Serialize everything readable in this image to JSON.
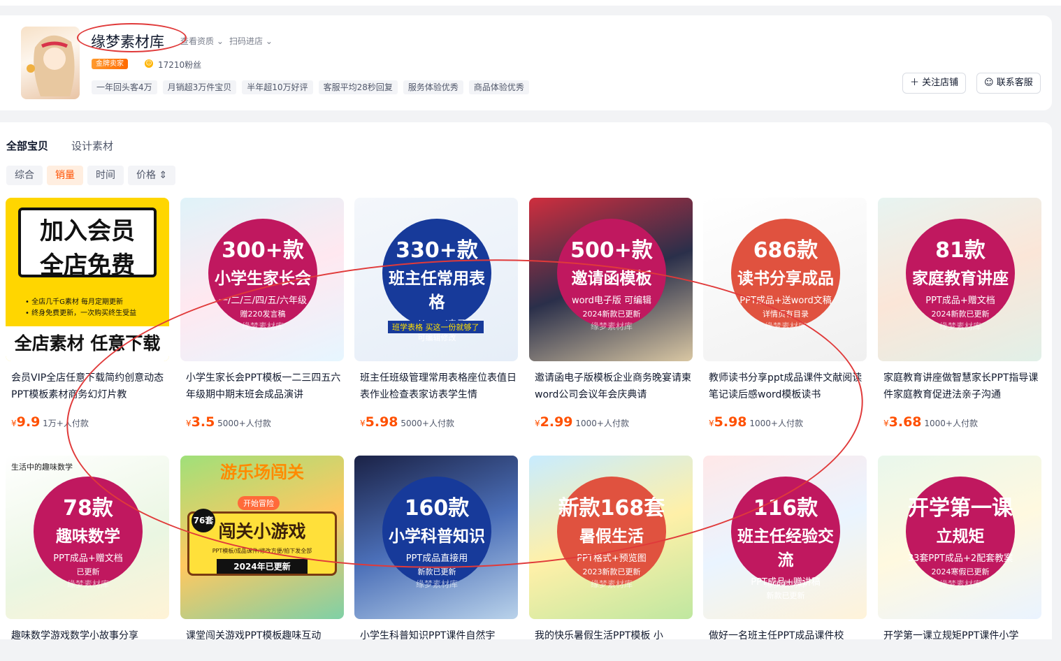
{
  "shop": {
    "name": "缘梦素材库",
    "view_qual": "查看资质",
    "scan": "扫码进店",
    "badge": "金牌卖家",
    "fans": "17210粉丝",
    "tags": [
      "一年回头客4万",
      "月销超3万件宝贝",
      "半年超10万好评",
      "客服平均28秒回复",
      "服务体验优秀",
      "商品体验优秀"
    ],
    "follow": "关注店铺",
    "service": "联系客服"
  },
  "categories": [
    "全部宝贝",
    "设计素材"
  ],
  "sorts": [
    "综合",
    "销量",
    "时间",
    "价格"
  ],
  "watermark": "缘梦素材库",
  "products": [
    {
      "big": "加入会员",
      "title2": "全店免费",
      "bul1": "• 全店几千G素材 每月定期更新",
      "bul2": "• 终身免费更新，一次购买终生受益",
      "footer": "全店素材 任意下载",
      "title": "会员VIP全店任意下载简约创意动态PPT模板素材商务幻灯片教",
      "price": "9.9",
      "sold": "1万+人付款"
    },
    {
      "big": "300+款",
      "ctitle": "小学生家长会",
      "sub": "一/二/三/四/五/六年级",
      "sub2": "赠220发言稿",
      "title": "小学生家长会PPT模板一二三四五六年级期中期末班会成品演讲",
      "price": "3.5",
      "sold": "5000+人付款"
    },
    {
      "big": "330+款",
      "ctitle": "班主任常用表格",
      "sub": "word/excel电子版",
      "sub2": "可编辑修改",
      "sub3": "班学表格 买这一份就够了",
      "title": "班主任班级管理常用表格座位表值日表作业检查表家访表学生情",
      "price": "5.98",
      "sold": "5000+人付款"
    },
    {
      "big": "500+款",
      "ctitle": "邀请函模板",
      "sub": "word电子版 可编辑",
      "sub2": "2024新款已更新",
      "title": "邀请函电子版模板企业商务晚宴请柬word公司会议年会庆典请",
      "price": "2.99",
      "sold": "1000+人付款"
    },
    {
      "big": "686款",
      "ctitle": "读书分享成品",
      "sub": "PPT成品+送word文稿",
      "sub2": "详情页有目录",
      "title": "教师读书分享ppt成品课件文献阅读笔记读后感word模板读书",
      "price": "5.98",
      "sold": "1000+人付款"
    },
    {
      "big": "81款",
      "ctitle": "家庭教育讲座",
      "sub": "PPT成品+赠文档",
      "sub2": "2024新款已更新",
      "title": "家庭教育讲座做智慧家长PPT指导课件家庭教育促进法亲子沟通",
      "price": "3.68",
      "sold": "1000+人付款"
    },
    {
      "big": "78款",
      "ctitle": "趣味数学",
      "sub": "PPT成品+赠文档",
      "sub2": "已更新",
      "title": "趣味数学游戏数学小故事分享",
      "top": "生活中的趣味数学"
    },
    {
      "big": "闯关小游戏",
      "ctitle": "游乐场闯关",
      "sub": "PPT模板/成品课件/修改方便/拍下发全部",
      "sub2": "2024年已更新",
      "badge": "76套",
      "title": "课堂闯关游戏PPT模板趣味互动",
      "start": "开始冒险"
    },
    {
      "big": "160款",
      "ctitle": "小学科普知识",
      "sub": "PPT成品直接用",
      "sub2": "新款已更新",
      "title": "小学生科普知识PPT课件自然宇"
    },
    {
      "big": "新款168套",
      "ctitle": "暑假生活",
      "sub": "PPT格式+预览图",
      "sub2": "2023新款已更新",
      "title": "我的快乐暑假生活PPT模板 小"
    },
    {
      "big": "116款",
      "ctitle": "班主任经验交流",
      "sub": "PPT成品+赠讲稿",
      "sub2": "新款已更新",
      "title": "做好一名班主任PPT成品课件校"
    },
    {
      "big": "开学第一课",
      "ctitle": "立规矩",
      "sub": "33套PPT成品+2配套教案",
      "sub2": "2024寒假已更新",
      "title": "开学第一课立规矩PPT课件小学"
    }
  ],
  "colors": {
    "accent": "#ff5000",
    "circle1": "#c0185f",
    "circle2": "#173a9a",
    "circle3": "#e0523f"
  }
}
